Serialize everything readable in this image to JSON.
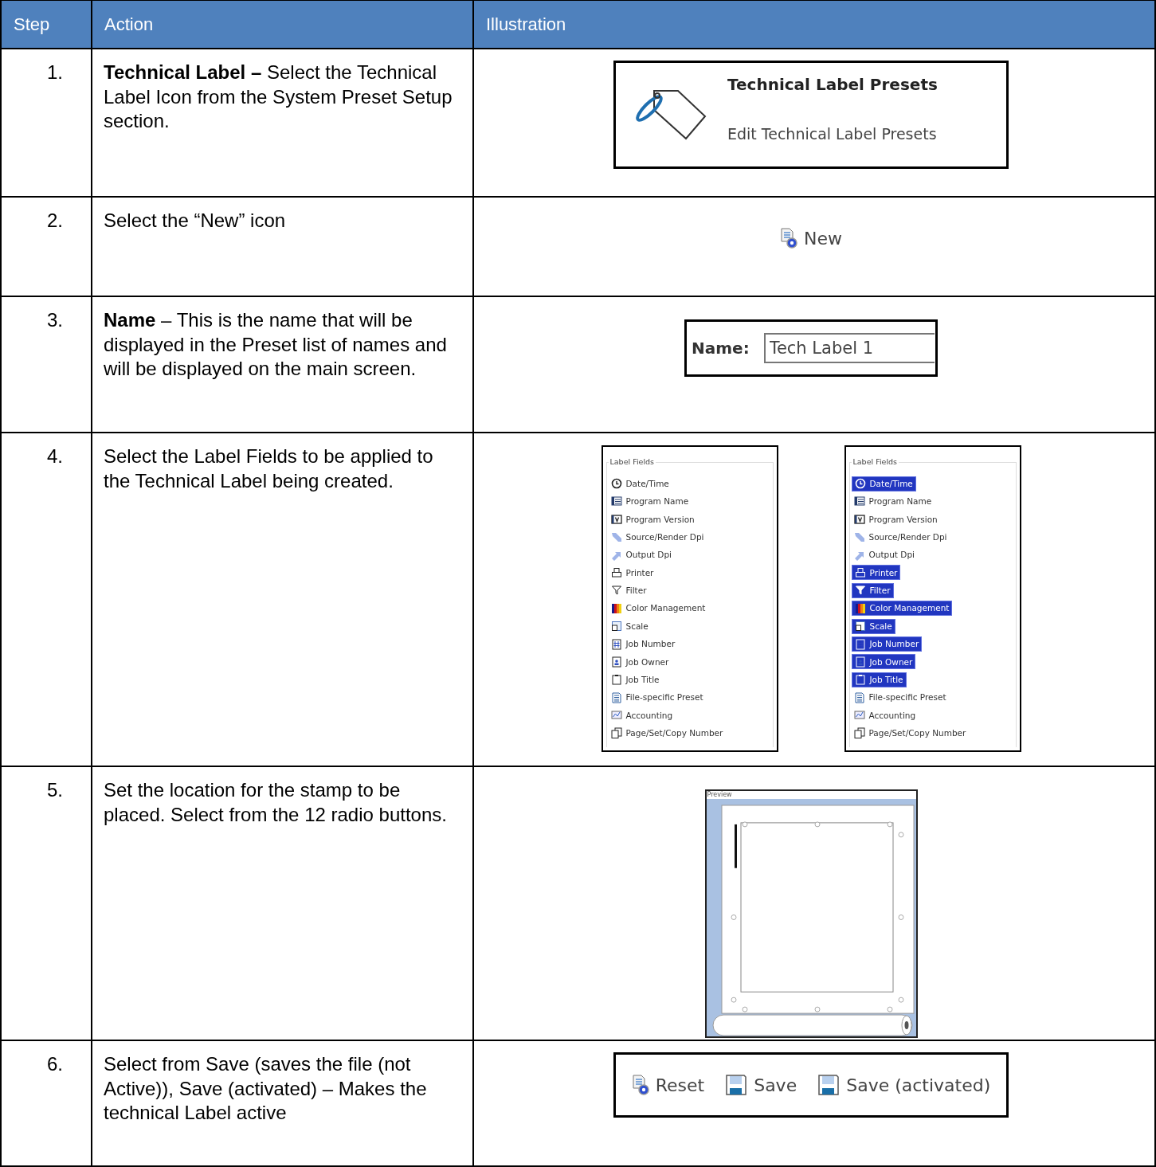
{
  "table": {
    "columns": [
      "Step",
      "Action",
      "Illustration"
    ],
    "rows": [
      {
        "step": "1.",
        "action": "**Technical Label –** Select the Technical Label Icon from the System Preset Setup section.",
        "illustration": {
          "kind": "preset_card",
          "title": "Technical Label Presets",
          "subtitle": "Edit Technical Label Presets"
        }
      },
      {
        "step": "2.",
        "action": "Select the “New” icon",
        "illustration": {
          "kind": "toolbar",
          "buttons": [
            {
              "kind": "new",
              "label": "New"
            }
          ]
        }
      },
      {
        "step": "3.",
        "action": "**Name** – This is the name that will be displayed in the Preset list of names and will be displayed on the main screen.",
        "illustration": {
          "kind": "name_field",
          "label": "Name:",
          "value": "Tech Label 1"
        }
      },
      {
        "step": "4.",
        "action": "Select the Label Fields to be applied to the Technical Label being created.",
        "illustration": {
          "kind": "field_lists",
          "lists": [
            {
              "title": "Label Fields",
              "items": [
                {
                  "label": "Date/Time",
                  "selected": false
                },
                {
                  "label": "Program Name",
                  "selected": false
                },
                {
                  "label": "Program Version",
                  "selected": false
                },
                {
                  "label": "Source/Render Dpi",
                  "selected": false
                },
                {
                  "label": "Output Dpi",
                  "selected": false
                },
                {
                  "label": "Printer",
                  "selected": false
                },
                {
                  "label": "Filter",
                  "selected": false
                },
                {
                  "label": "Color Management",
                  "selected": false
                },
                {
                  "label": "Scale",
                  "selected": false
                },
                {
                  "label": "Job Number",
                  "selected": false
                },
                {
                  "label": "Job Owner",
                  "selected": false
                },
                {
                  "label": "Job Title",
                  "selected": false
                },
                {
                  "label": "File-specific Preset",
                  "selected": false
                },
                {
                  "label": "Accounting",
                  "selected": false
                },
                {
                  "label": "Page/Set/Copy Number",
                  "selected": false
                }
              ]
            },
            {
              "title": "Label Fields",
              "items": [
                {
                  "label": "Date/Time",
                  "selected": true
                },
                {
                  "label": "Program Name",
                  "selected": false
                },
                {
                  "label": "Program Version",
                  "selected": false
                },
                {
                  "label": "Source/Render Dpi",
                  "selected": false
                },
                {
                  "label": "Output Dpi",
                  "selected": false
                },
                {
                  "label": "Printer",
                  "selected": true
                },
                {
                  "label": "Filter",
                  "selected": true
                },
                {
                  "label": "Color Management",
                  "selected": true
                },
                {
                  "label": "Scale",
                  "selected": true
                },
                {
                  "label": "Job Number",
                  "selected": true
                },
                {
                  "label": "Job Owner",
                  "selected": true
                },
                {
                  "label": "Job Title",
                  "selected": true
                },
                {
                  "label": "File-specific Preset",
                  "selected": false
                },
                {
                  "label": "Accounting",
                  "selected": false
                },
                {
                  "label": "Page/Set/Copy Number",
                  "selected": false
                }
              ]
            }
          ]
        }
      },
      {
        "step": "5.",
        "action": "Set the location for the stamp to be placed. Select from the 12 radio buttons.",
        "illustration": {
          "kind": "preview",
          "title": "Preview"
        }
      },
      {
        "step": "6.",
        "action": "Select from Save (saves the file (not Active)), Save (activated) – Makes the technical Label active",
        "illustration": {
          "kind": "framed_toolbar",
          "buttons": [
            {
              "kind": "reset",
              "label": "Reset"
            },
            {
              "kind": "save",
              "label": "Save"
            },
            {
              "kind": "save",
              "label": "Save (activated)"
            }
          ]
        }
      }
    ]
  }
}
